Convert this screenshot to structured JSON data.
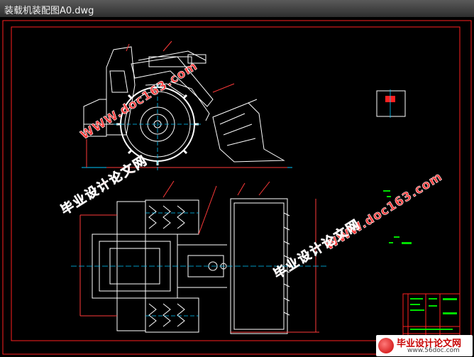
{
  "window": {
    "title": "装载机装配图A0.dwg"
  },
  "watermarks": {
    "cn_text": "毕业设计论文网",
    "url_text": "WWW.doc163.com"
  },
  "badge": {
    "cn_text": "毕业设计论文网",
    "url_text": "www.56doc.com"
  },
  "colors": {
    "frame": "#ff2020",
    "lines": "#ffffff",
    "center": "#00c8ff",
    "dims": "#ff3a3a",
    "annot": "#00e000",
    "wm_fill": "#ff3a3a",
    "wm_stroke": "#ffffff"
  }
}
